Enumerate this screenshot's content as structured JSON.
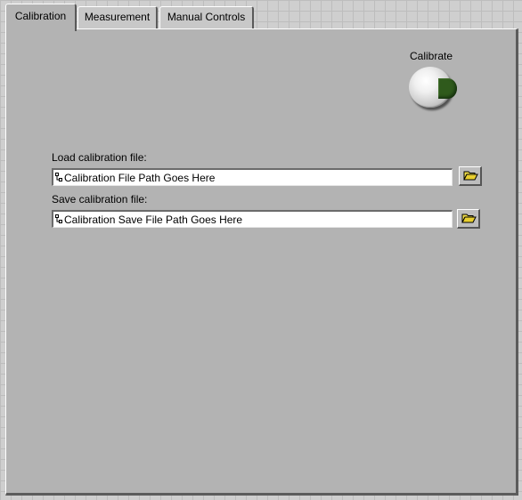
{
  "tabs": [
    {
      "label": "Calibration",
      "active": true
    },
    {
      "label": "Measurement",
      "active": false
    },
    {
      "label": "Manual Controls",
      "active": false
    }
  ],
  "calibrate": {
    "label": "Calibrate",
    "icon": "led-indicator",
    "led_color": "#2f5a1c"
  },
  "load_file": {
    "label": "Load calibration file:",
    "value": "Calibration File Path Goes Here",
    "icon": "path-glyph-icon",
    "browse_icon": "folder-open-icon"
  },
  "save_file": {
    "label": "Save calibration file:",
    "value": "Calibration Save File Path Goes Here",
    "icon": "path-glyph-icon",
    "browse_icon": "folder-open-icon"
  },
  "colors": {
    "panel": "#b3b3b3",
    "grid_background": "#cfcfcf",
    "folder_icon": "#f2df4a"
  }
}
